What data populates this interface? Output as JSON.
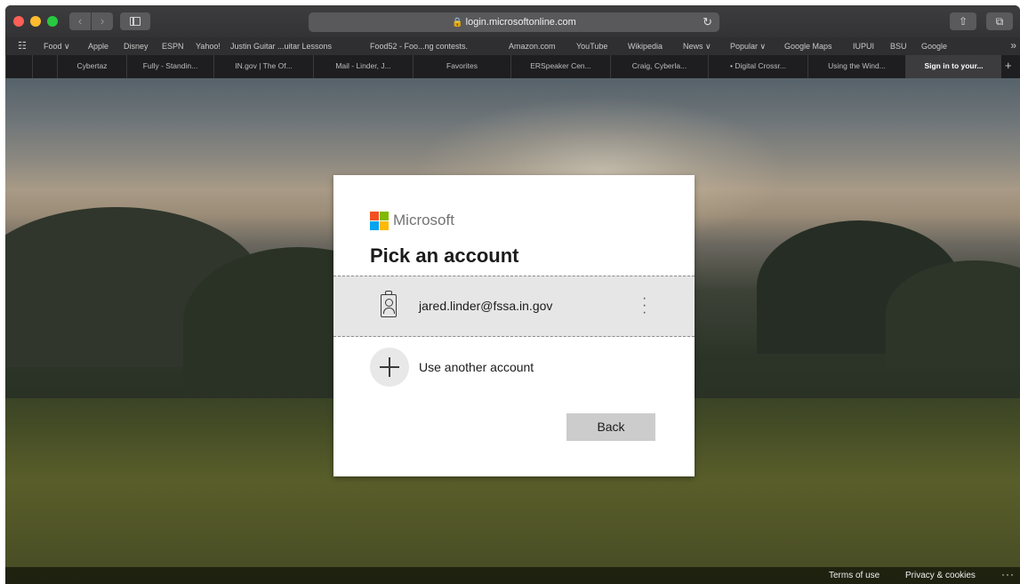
{
  "browser": {
    "url": "login.microsoftonline.com",
    "bookmarks": [
      "Food ∨",
      "Apple",
      "Disney",
      "ESPN",
      "Yahoo!",
      "Justin Guitar ...uitar Lessons",
      "Food52 - Foo...ng contests.",
      "Amazon.com",
      "YouTube",
      "Wikipedia",
      "News ∨",
      "Popular ∨",
      "Google Maps",
      "IUPUI",
      "BSU",
      "Google"
    ],
    "tabs": [
      "",
      "Cybertaz",
      "Fully - Standin...",
      "IN.gov | The Of...",
      "Mail - Linder, J...",
      "Favorites",
      "ERSpeaker Cen...",
      "Craig, Cyberla...",
      "• Digital Crossr...",
      "Using the Wind...",
      "Sign in to your..."
    ],
    "active_tab_index": 10
  },
  "dialog": {
    "brand": "Microsoft",
    "title": "Pick an account",
    "account_email": "jared.linder@fssa.in.gov",
    "add_account_label": "Use another account",
    "back_label": "Back"
  },
  "footer": {
    "terms": "Terms of use",
    "privacy": "Privacy & cookies",
    "more": "···"
  },
  "icons": [
    "close-dot",
    "minimize-dot",
    "zoom-dot",
    "back-arrow-icon",
    "forward-arrow-icon",
    "sidebar-icon",
    "lock-icon",
    "reload-icon",
    "share-icon",
    "tabs-icon",
    "grid-icon",
    "badge-icon",
    "kebab-icon",
    "plus-icon"
  ],
  "colors": {
    "ms_red": "#f25022",
    "ms_green": "#7fba00",
    "ms_blue": "#00a4ef",
    "ms_yellow": "#ffb900",
    "selected_row": "#e6e6e6",
    "back_button": "#cccccc"
  }
}
